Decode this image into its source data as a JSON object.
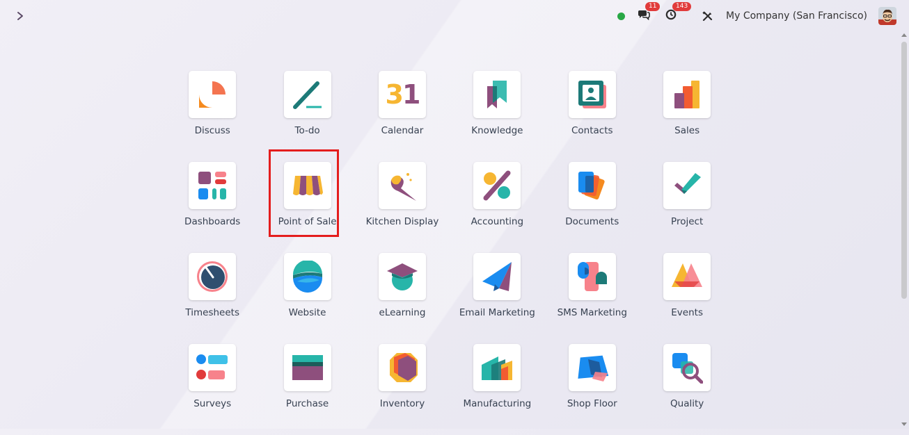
{
  "topbar": {
    "messages_count": "11",
    "activities_count": "143",
    "company_name": "My Company (San Francisco)"
  },
  "apps": [
    {
      "label": "Discuss",
      "icon": "discuss-icon"
    },
    {
      "label": "To-do",
      "icon": "todo-icon"
    },
    {
      "label": "Calendar",
      "icon": "calendar-icon",
      "icon_text": "31"
    },
    {
      "label": "Knowledge",
      "icon": "knowledge-icon"
    },
    {
      "label": "Contacts",
      "icon": "contacts-icon"
    },
    {
      "label": "Sales",
      "icon": "sales-icon"
    },
    {
      "label": "Dashboards",
      "icon": "dashboards-icon"
    },
    {
      "label": "Point of Sale",
      "icon": "point-of-sale-icon",
      "highlighted": true
    },
    {
      "label": "Kitchen Display",
      "icon": "kitchen-display-icon"
    },
    {
      "label": "Accounting",
      "icon": "accounting-icon"
    },
    {
      "label": "Documents",
      "icon": "documents-icon"
    },
    {
      "label": "Project",
      "icon": "project-icon"
    },
    {
      "label": "Timesheets",
      "icon": "timesheets-icon"
    },
    {
      "label": "Website",
      "icon": "website-icon"
    },
    {
      "label": "eLearning",
      "icon": "elearning-icon"
    },
    {
      "label": "Email Marketing",
      "icon": "email-marketing-icon"
    },
    {
      "label": "SMS Marketing",
      "icon": "sms-marketing-icon"
    },
    {
      "label": "Events",
      "icon": "events-icon"
    },
    {
      "label": "Surveys",
      "icon": "surveys-icon"
    },
    {
      "label": "Purchase",
      "icon": "purchase-icon"
    },
    {
      "label": "Inventory",
      "icon": "inventory-icon"
    },
    {
      "label": "Manufacturing",
      "icon": "manufacturing-icon"
    },
    {
      "label": "Shop Floor",
      "icon": "shop-floor-icon"
    },
    {
      "label": "Quality",
      "icon": "quality-icon"
    }
  ],
  "colors": {
    "highlight": "#e41d1d",
    "badge": "#e13b3b",
    "presence": "#28a745"
  }
}
